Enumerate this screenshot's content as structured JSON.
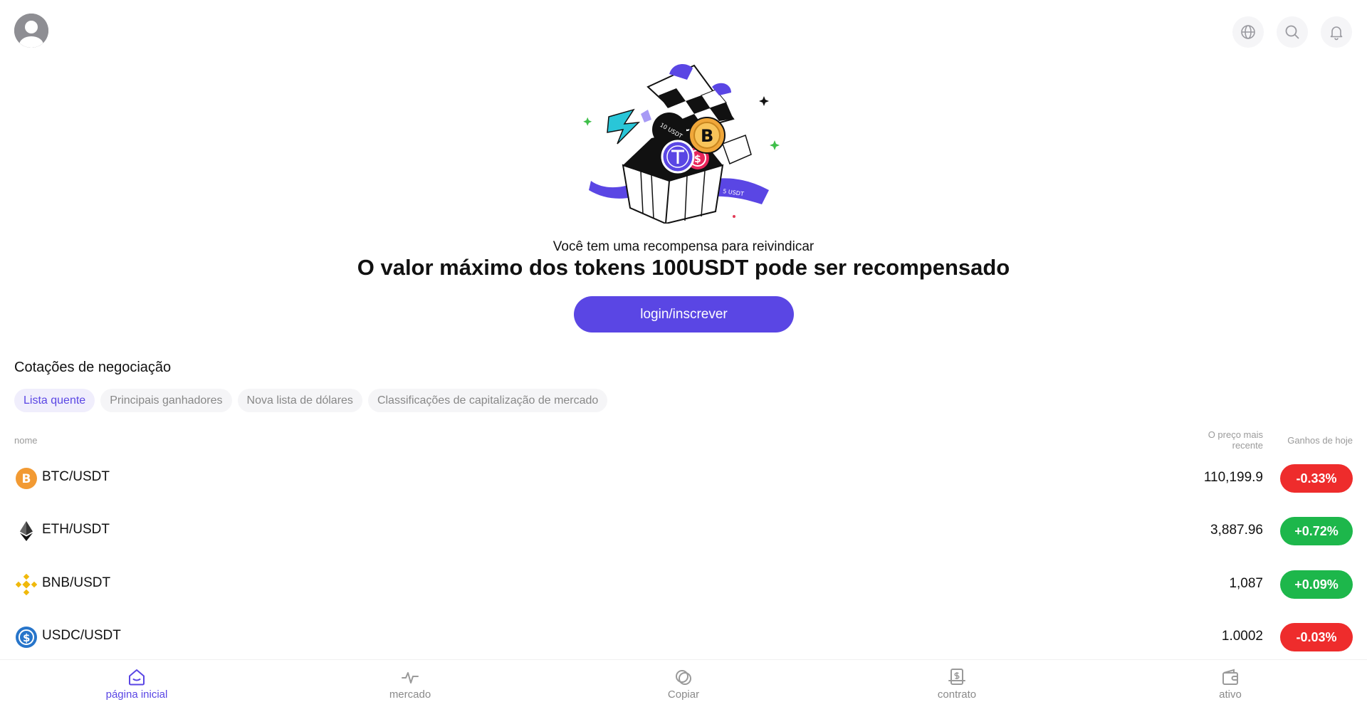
{
  "header": {
    "icons": [
      "avatar",
      "globe-icon",
      "search-icon",
      "bell-icon"
    ]
  },
  "hero": {
    "subtitle": "Você tem uma recompensa para reivindicar",
    "title": "O valor máximo dos tokens 100USDT pode ser recompensado",
    "login_label": "login/inscrever",
    "illustration_text": [
      "10 USDT",
      "5 USDT"
    ]
  },
  "quotes": {
    "title": "Cotações de negociação",
    "tabs": [
      {
        "label": "Lista quente",
        "active": true
      },
      {
        "label": "Principais ganhadores",
        "active": false
      },
      {
        "label": "Nova lista de dólares",
        "active": false
      },
      {
        "label": "Classificações de capitalização de mercado",
        "active": false
      }
    ],
    "columns": {
      "name": "nome",
      "price": "O preço mais recente",
      "change": "Ganhos de hoje"
    },
    "rows": [
      {
        "pair": "BTC/USDT",
        "price": "110,199.9",
        "change": "-0.33%",
        "direction": "down",
        "icon": "btc-icon"
      },
      {
        "pair": "ETH/USDT",
        "price": "3,887.96",
        "change": "+0.72%",
        "direction": "up",
        "icon": "eth-icon"
      },
      {
        "pair": "BNB/USDT",
        "price": "1,087",
        "change": "+0.09%",
        "direction": "up",
        "icon": "bnb-icon"
      },
      {
        "pair": "USDC/USDT",
        "price": "1.0002",
        "change": "-0.03%",
        "direction": "down",
        "icon": "usdc-icon"
      }
    ]
  },
  "bottom_nav": [
    {
      "label": "página inicial",
      "icon": "home-icon",
      "active": true
    },
    {
      "label": "mercado",
      "icon": "pulse-icon",
      "active": false
    },
    {
      "label": "Copiar",
      "icon": "copy-icon",
      "active": false
    },
    {
      "label": "contrato",
      "icon": "contract-icon",
      "active": false
    },
    {
      "label": "ativo",
      "icon": "wallet-icon",
      "active": false
    }
  ],
  "colors": {
    "accent": "#5a46e4",
    "up": "#1db74b",
    "down": "#ee2c2c",
    "muted": "#8a8a8a"
  }
}
